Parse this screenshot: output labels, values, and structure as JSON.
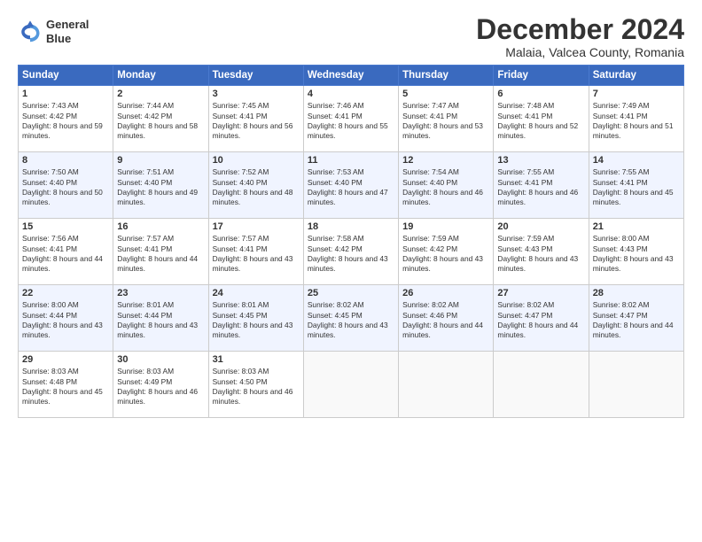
{
  "header": {
    "logo_line1": "General",
    "logo_line2": "Blue",
    "month": "December 2024",
    "location": "Malaia, Valcea County, Romania"
  },
  "weekdays": [
    "Sunday",
    "Monday",
    "Tuesday",
    "Wednesday",
    "Thursday",
    "Friday",
    "Saturday"
  ],
  "weeks": [
    [
      {
        "day": "1",
        "sunrise": "7:43 AM",
        "sunset": "4:42 PM",
        "daylight": "8 hours and 59 minutes."
      },
      {
        "day": "2",
        "sunrise": "7:44 AM",
        "sunset": "4:42 PM",
        "daylight": "8 hours and 58 minutes."
      },
      {
        "day": "3",
        "sunrise": "7:45 AM",
        "sunset": "4:41 PM",
        "daylight": "8 hours and 56 minutes."
      },
      {
        "day": "4",
        "sunrise": "7:46 AM",
        "sunset": "4:41 PM",
        "daylight": "8 hours and 55 minutes."
      },
      {
        "day": "5",
        "sunrise": "7:47 AM",
        "sunset": "4:41 PM",
        "daylight": "8 hours and 53 minutes."
      },
      {
        "day": "6",
        "sunrise": "7:48 AM",
        "sunset": "4:41 PM",
        "daylight": "8 hours and 52 minutes."
      },
      {
        "day": "7",
        "sunrise": "7:49 AM",
        "sunset": "4:41 PM",
        "daylight": "8 hours and 51 minutes."
      }
    ],
    [
      {
        "day": "8",
        "sunrise": "7:50 AM",
        "sunset": "4:40 PM",
        "daylight": "8 hours and 50 minutes."
      },
      {
        "day": "9",
        "sunrise": "7:51 AM",
        "sunset": "4:40 PM",
        "daylight": "8 hours and 49 minutes."
      },
      {
        "day": "10",
        "sunrise": "7:52 AM",
        "sunset": "4:40 PM",
        "daylight": "8 hours and 48 minutes."
      },
      {
        "day": "11",
        "sunrise": "7:53 AM",
        "sunset": "4:40 PM",
        "daylight": "8 hours and 47 minutes."
      },
      {
        "day": "12",
        "sunrise": "7:54 AM",
        "sunset": "4:40 PM",
        "daylight": "8 hours and 46 minutes."
      },
      {
        "day": "13",
        "sunrise": "7:55 AM",
        "sunset": "4:41 PM",
        "daylight": "8 hours and 46 minutes."
      },
      {
        "day": "14",
        "sunrise": "7:55 AM",
        "sunset": "4:41 PM",
        "daylight": "8 hours and 45 minutes."
      }
    ],
    [
      {
        "day": "15",
        "sunrise": "7:56 AM",
        "sunset": "4:41 PM",
        "daylight": "8 hours and 44 minutes."
      },
      {
        "day": "16",
        "sunrise": "7:57 AM",
        "sunset": "4:41 PM",
        "daylight": "8 hours and 44 minutes."
      },
      {
        "day": "17",
        "sunrise": "7:57 AM",
        "sunset": "4:41 PM",
        "daylight": "8 hours and 43 minutes."
      },
      {
        "day": "18",
        "sunrise": "7:58 AM",
        "sunset": "4:42 PM",
        "daylight": "8 hours and 43 minutes."
      },
      {
        "day": "19",
        "sunrise": "7:59 AM",
        "sunset": "4:42 PM",
        "daylight": "8 hours and 43 minutes."
      },
      {
        "day": "20",
        "sunrise": "7:59 AM",
        "sunset": "4:43 PM",
        "daylight": "8 hours and 43 minutes."
      },
      {
        "day": "21",
        "sunrise": "8:00 AM",
        "sunset": "4:43 PM",
        "daylight": "8 hours and 43 minutes."
      }
    ],
    [
      {
        "day": "22",
        "sunrise": "8:00 AM",
        "sunset": "4:44 PM",
        "daylight": "8 hours and 43 minutes."
      },
      {
        "day": "23",
        "sunrise": "8:01 AM",
        "sunset": "4:44 PM",
        "daylight": "8 hours and 43 minutes."
      },
      {
        "day": "24",
        "sunrise": "8:01 AM",
        "sunset": "4:45 PM",
        "daylight": "8 hours and 43 minutes."
      },
      {
        "day": "25",
        "sunrise": "8:02 AM",
        "sunset": "4:45 PM",
        "daylight": "8 hours and 43 minutes."
      },
      {
        "day": "26",
        "sunrise": "8:02 AM",
        "sunset": "4:46 PM",
        "daylight": "8 hours and 44 minutes."
      },
      {
        "day": "27",
        "sunrise": "8:02 AM",
        "sunset": "4:47 PM",
        "daylight": "8 hours and 44 minutes."
      },
      {
        "day": "28",
        "sunrise": "8:02 AM",
        "sunset": "4:47 PM",
        "daylight": "8 hours and 44 minutes."
      }
    ],
    [
      {
        "day": "29",
        "sunrise": "8:03 AM",
        "sunset": "4:48 PM",
        "daylight": "8 hours and 45 minutes."
      },
      {
        "day": "30",
        "sunrise": "8:03 AM",
        "sunset": "4:49 PM",
        "daylight": "8 hours and 46 minutes."
      },
      {
        "day": "31",
        "sunrise": "8:03 AM",
        "sunset": "4:50 PM",
        "daylight": "8 hours and 46 minutes."
      },
      null,
      null,
      null,
      null
    ]
  ]
}
